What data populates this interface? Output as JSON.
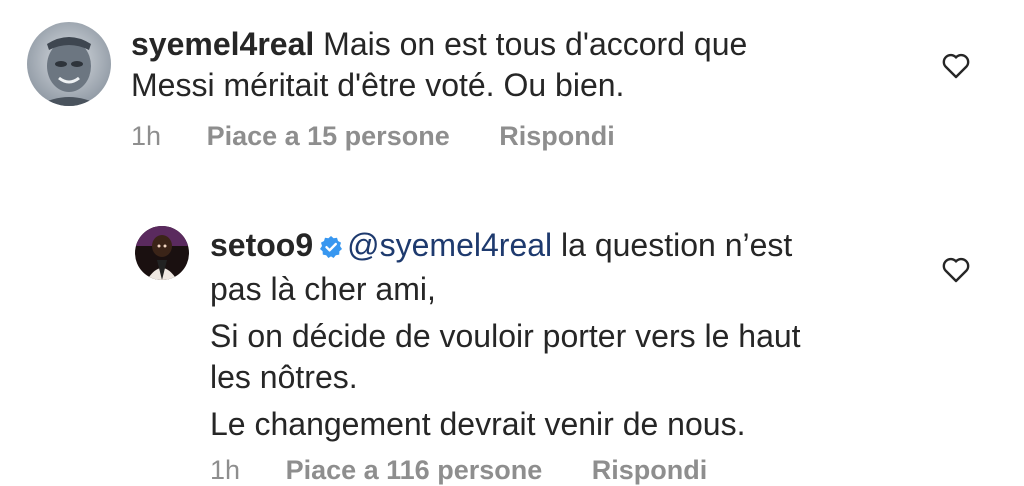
{
  "comments": [
    {
      "username": "syemel4real",
      "text_line1": "Mais on est tous d'accord que",
      "text_line2": "Messi méritait d'être voté. Ou bien.",
      "time": "1h",
      "likes": "Piace a 15 persone",
      "reply": "Rispondi"
    },
    {
      "username": "setoo9",
      "verified": true,
      "mention": "@syemel4real",
      "text_line1_rest": " la question n’est",
      "text_line2": "pas là cher ami,",
      "text_line3": "Si on décide de vouloir porter vers le haut",
      "text_line4": "les nôtres.",
      "text_line5": "Le changement devrait venir de nous.",
      "time": "1h",
      "likes": "Piace a 116 persone",
      "reply": "Rispondi"
    }
  ],
  "colors": {
    "text": "#262626",
    "secondary": "#8e8e8e",
    "mention": "#1e3a6e",
    "verified": "#3897f0"
  },
  "icons": {
    "like": "heart-outline-icon",
    "verified": "verified-badge-icon"
  }
}
